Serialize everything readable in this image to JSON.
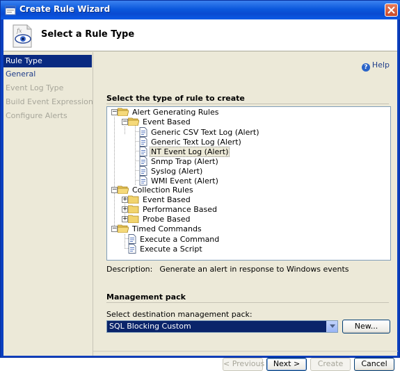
{
  "window": {
    "title": "Create Rule Wizard"
  },
  "header": {
    "title": "Select a Rule Type"
  },
  "nav": {
    "items": [
      {
        "label": "Rule Type",
        "state": "active"
      },
      {
        "label": "General",
        "state": "link"
      },
      {
        "label": "Event Log Type",
        "state": "disabled"
      },
      {
        "label": "Build Event Expression",
        "state": "disabled"
      },
      {
        "label": "Configure Alerts",
        "state": "disabled"
      }
    ]
  },
  "help": {
    "label": "Help"
  },
  "rule_section": {
    "title": "Select the type of rule to create"
  },
  "tree": {
    "nodes": [
      {
        "label": "Alert Generating Rules",
        "icon": "folder-open"
      },
      {
        "label": "Event Based",
        "icon": "folder-open"
      },
      {
        "label": "Generic CSV Text Log (Alert)",
        "icon": "rule-doc"
      },
      {
        "label": "Generic Text Log (Alert)",
        "icon": "rule-doc"
      },
      {
        "label": "NT Event Log (Alert)",
        "icon": "rule-doc",
        "selected": true
      },
      {
        "label": "Snmp Trap (Alert)",
        "icon": "rule-doc"
      },
      {
        "label": "Syslog (Alert)",
        "icon": "rule-doc"
      },
      {
        "label": "WMI Event (Alert)",
        "icon": "rule-doc"
      },
      {
        "label": "Collection Rules",
        "icon": "folder-open"
      },
      {
        "label": "Event Based",
        "icon": "folder"
      },
      {
        "label": "Performance Based",
        "icon": "folder"
      },
      {
        "label": "Probe Based",
        "icon": "folder"
      },
      {
        "label": "Timed Commands",
        "icon": "folder-open"
      },
      {
        "label": "Execute a Command",
        "icon": "rule-doc"
      },
      {
        "label": "Execute a Script",
        "icon": "rule-doc"
      }
    ]
  },
  "description": {
    "label": "Description:",
    "text": "Generate an alert in response to Windows events"
  },
  "management_pack": {
    "title": "Management pack",
    "select_label": "Select destination management pack:",
    "selected": "SQL Blocking Custom",
    "new_label": "New..."
  },
  "buttons": {
    "previous": "< Previous",
    "next": "Next >",
    "create": "Create",
    "cancel": "Cancel"
  },
  "colors": {
    "titlebar": "#0b58dc",
    "selection": "#0a246a",
    "face": "#ece9d8",
    "link": "#1f3d8a"
  }
}
